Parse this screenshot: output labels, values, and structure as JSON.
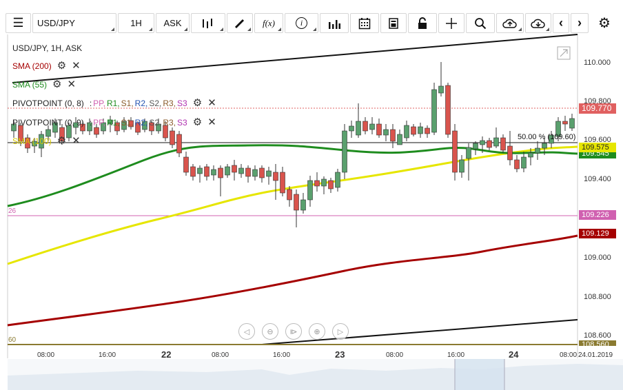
{
  "toolbar": {
    "symbol": "USD/JPY",
    "timeframe": "1H",
    "price_type": "ASK",
    "function_label": "f(x)"
  },
  "legend": {
    "title": "USD/JPY, 1H, ASK",
    "sma200": "SMA (200)",
    "sma55": "SMA (55)",
    "pivot8_name": "PIVOTPOINT (0, 8)",
    "pivot9_name": "PIVOTPOINT (0, 9)",
    "sma100": "SMA (100)",
    "pivot_sep": ":",
    "pivot_levels": [
      "PP,",
      "R1,",
      "S1,",
      "R2,",
      "S2,",
      "R3,",
      "S3"
    ]
  },
  "y_axis": {
    "ticks": [
      "110.000",
      "109.800",
      "109.600",
      "109.400",
      "109.000",
      "108.800",
      "108.600"
    ]
  },
  "price_labels": {
    "last": "109.770",
    "sma100": "109.575",
    "sma55": "109.545",
    "pink": "109.226",
    "sma200": "109.129",
    "bottom": "108.560"
  },
  "annotations": {
    "fib": "50.00 % (109.60)",
    "left_26": "26",
    "left_60": "60"
  },
  "x_axis": {
    "labels": [
      "08:00",
      "16:00",
      "22",
      "08:00",
      "16:00",
      "23",
      "08:00",
      "16:00",
      "24",
      "08:00",
      "24.01.2019"
    ]
  },
  "colors": {
    "sma200": "#a50000",
    "sma55": "#1e8c1e",
    "sma100": "#e6e600",
    "up": "#5aa06e",
    "down": "#d9544d",
    "pink": "#d060b0"
  }
}
